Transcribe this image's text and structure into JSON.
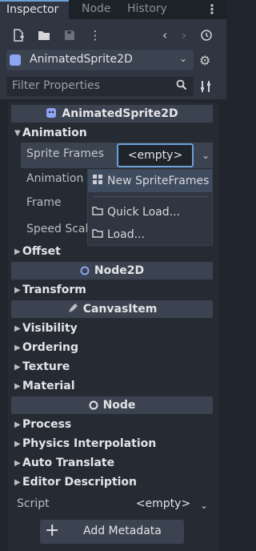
{
  "tabs": [
    {
      "label": "Inspector",
      "active": true
    },
    {
      "label": "Node",
      "active": false
    },
    {
      "label": "History",
      "active": false
    }
  ],
  "toolbar": {
    "icons": [
      "new-resource-icon",
      "open-folder-icon",
      "save-icon",
      "more-menu-icon",
      "back-icon",
      "forward-icon",
      "history-icon"
    ]
  },
  "object": {
    "name": "AnimatedSprite2D",
    "icon": "animated-sprite-icon"
  },
  "filter": {
    "placeholder": "Filter Properties",
    "value": ""
  },
  "inspector": {
    "class_title": "AnimatedSprite2D",
    "animation_section": "Animation",
    "sprite_frames_label": "Sprite Frames",
    "sprite_frames_value": "<empty>",
    "animation_label": "Animation",
    "frame_label": "Frame",
    "speed_scale_label": "Speed Scale",
    "offset_section": "Offset",
    "node2d_title": "Node2D",
    "transform_section": "Transform",
    "canvasitem_title": "CanvasItem",
    "visibility_section": "Visibility",
    "ordering_section": "Ordering",
    "texture_section": "Texture",
    "material_section": "Material",
    "node_title": "Node",
    "process_section": "Process",
    "physics_section": "Physics Interpolation",
    "auto_translate_section": "Auto Translate",
    "editor_desc_section": "Editor Description",
    "script_label": "Script",
    "script_value": "<empty>",
    "add_metadata": "Add Metadata"
  },
  "dropdown": {
    "items": [
      {
        "label": "New SpriteFrames",
        "icon": "sprite-frames-icon",
        "highlighted": true
      },
      {
        "label": "Quick Load...",
        "icon": "folder-icon",
        "highlighted": false
      },
      {
        "label": "Load...",
        "icon": "folder-icon",
        "highlighted": false
      }
    ]
  },
  "colors": {
    "accent": "#6d9fd8",
    "panel_bg": "#262b33",
    "header_bg": "#3b4250"
  }
}
